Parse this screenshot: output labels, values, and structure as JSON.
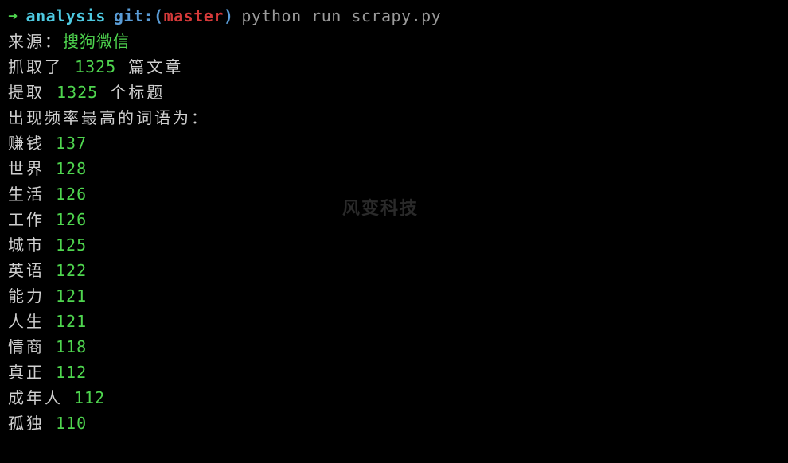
{
  "prompt": {
    "arrow": "➜",
    "directory": "analysis",
    "git_label": "git:(",
    "branch": "master",
    "git_close": ")",
    "command": "python run_scrapy.py"
  },
  "output": {
    "source_label": "来源：",
    "source_value": "搜狗微信",
    "scraped_prefix": "抓取了",
    "scraped_count": "1325",
    "scraped_suffix": "篇文章",
    "extracted_prefix": "提取",
    "extracted_count": "1325",
    "extracted_suffix": "个标题",
    "freq_header": "出现频率最高的词语为："
  },
  "words": [
    {
      "word": "赚钱",
      "count": "137"
    },
    {
      "word": "世界",
      "count": "128"
    },
    {
      "word": "生活",
      "count": "126"
    },
    {
      "word": "工作",
      "count": "126"
    },
    {
      "word": "城市",
      "count": "125"
    },
    {
      "word": "英语",
      "count": "122"
    },
    {
      "word": "能力",
      "count": "121"
    },
    {
      "word": "人生",
      "count": "121"
    },
    {
      "word": "情商",
      "count": "118"
    },
    {
      "word": "真正",
      "count": "112"
    },
    {
      "word": "成年人",
      "count": "112"
    },
    {
      "word": "孤独",
      "count": "110"
    }
  ],
  "watermark": "风变科技"
}
